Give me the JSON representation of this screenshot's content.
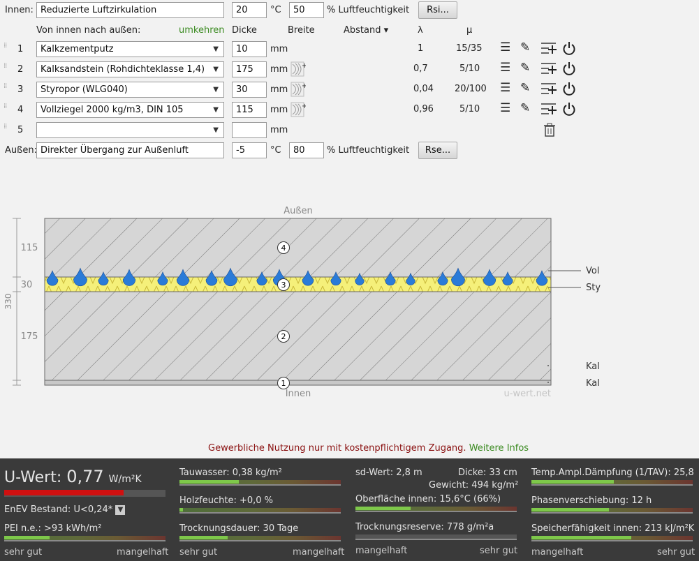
{
  "inside": {
    "label": "Innen:",
    "name": "Reduzierte Luftzirkulation",
    "temp": "20",
    "temp_unit": "°C",
    "humidity": "50",
    "humidity_unit": "% Luftfeuchtigkeit",
    "button": "Rsi..."
  },
  "outside": {
    "label": "Außen:",
    "name": "Direkter Übergang zur Außenluft",
    "temp": "-5",
    "temp_unit": "°C",
    "humidity": "80",
    "humidity_unit": "% Luftfeuchtigkeit",
    "button": "Rse..."
  },
  "headers": {
    "direction": "Von innen nach außen:",
    "reverse": "umkehren",
    "thickness": "Dicke",
    "width": "Breite",
    "distance": "Abstand ▾",
    "lambda": "λ",
    "mu": "μ"
  },
  "layers": [
    {
      "num": "1",
      "material": "Kalkzementputz",
      "thickness": "10",
      "unit": "mm",
      "lambda": "1",
      "mu": "15/35"
    },
    {
      "num": "2",
      "material": "Kalksandstein (Rohdichteklasse 1,4)",
      "thickness": "175",
      "unit": "mm",
      "lambda": "0,7",
      "mu": "5/10"
    },
    {
      "num": "3",
      "material": "Styropor (WLG040)",
      "thickness": "30",
      "unit": "mm",
      "lambda": "0,04",
      "mu": "20/100"
    },
    {
      "num": "4",
      "material": "Vollziegel 2000 kg/m3, DIN 105",
      "thickness": "115",
      "unit": "mm",
      "lambda": "0,96",
      "mu": "5/10"
    },
    {
      "num": "5",
      "material": "",
      "thickness": "",
      "unit": "mm",
      "lambda": "",
      "mu": ""
    }
  ],
  "diagram": {
    "top_label": "Außen",
    "bottom_label": "Innen",
    "watermark": "u-wert.net",
    "total": "330",
    "dims": [
      "115",
      "30",
      "175"
    ],
    "markers": [
      "4",
      "3",
      "2",
      "1"
    ],
    "side_labels": [
      "Vol",
      "Sty",
      "Kal",
      "Kal"
    ]
  },
  "notice": {
    "text": "Gewerbliche Nutzung nur mit kostenpflichtigem Zugang.",
    "link": "Weitere Infos"
  },
  "results": {
    "uwert_label": "U-Wert:",
    "uwert_value": "0,77",
    "uwert_unit": "W/m²K",
    "enev": "EnEV Bestand: U<0,24*",
    "pei": "PEI n.e.: >93 kWh/m²",
    "tauwasser": "Tauwasser: 0,38 kg/m²",
    "holzfeuchte": "Holzfeuchte: +0,0 %",
    "trocknungsdauer": "Trocknungsdauer: 30 Tage",
    "sd": "sd-Wert: 2,8 m",
    "dicke": "Dicke: 33 cm",
    "gewicht": "Gewicht: 494 kg/m²",
    "oberflaeche": "Oberfläche innen: 15,6°C (66%)",
    "trocknungsreserve": "Trocknungsreserve: 778 g/m²a",
    "tav": "Temp.Ampl.Dämpfung (1/TAV): 25,8",
    "phase": "Phasenverschiebung: 12 h",
    "speicher": "Speicherfähigkeit innen: 213 kJ/m²K",
    "scale": {
      "good": "sehr gut",
      "bad": "mangelhaft"
    }
  },
  "bar_levels": {
    "uwert": 0.74,
    "pei": 0.28,
    "tauwasser": 0.37,
    "holzfeuchte": 0.02,
    "trocknungsdauer": 0.3,
    "oberflaeche": 0.34,
    "trocknungsreserve": 0.0,
    "tav": 0.51,
    "phase": 0.48,
    "speicher": 0.62
  },
  "colors": {
    "reverse_link": "#3a8a20",
    "notice": "#8a1010",
    "notice_link": "#3a8a20",
    "insulation": "#f5f07a",
    "drop": "#2a7bd8"
  }
}
